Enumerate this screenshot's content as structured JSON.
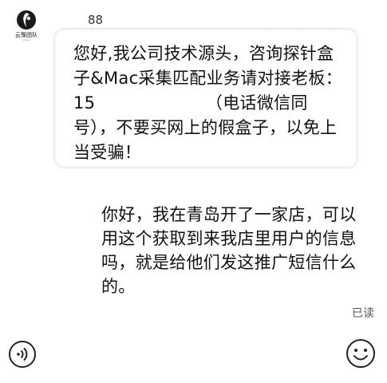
{
  "avatar": {
    "name": "云豫团队",
    "sub": "yunyu"
  },
  "sender": {
    "name_suffix": "88"
  },
  "messages": {
    "incoming": "您好,我公司技术源头，咨询探针盒子&Mac采集匹配业务请对接老板：15　　　　　　　（电话微信同号），不要买网上的假盒子，以免上当受骗！",
    "outgoing": "你好，我在青岛开了一家店，可以用这个获取到来我店里用户的信息吗，就是给他们发这推广短信什么的。"
  },
  "status": {
    "read": "已读"
  },
  "icons": {
    "voice": "voice-icon",
    "emoji": "emoji-icon"
  }
}
